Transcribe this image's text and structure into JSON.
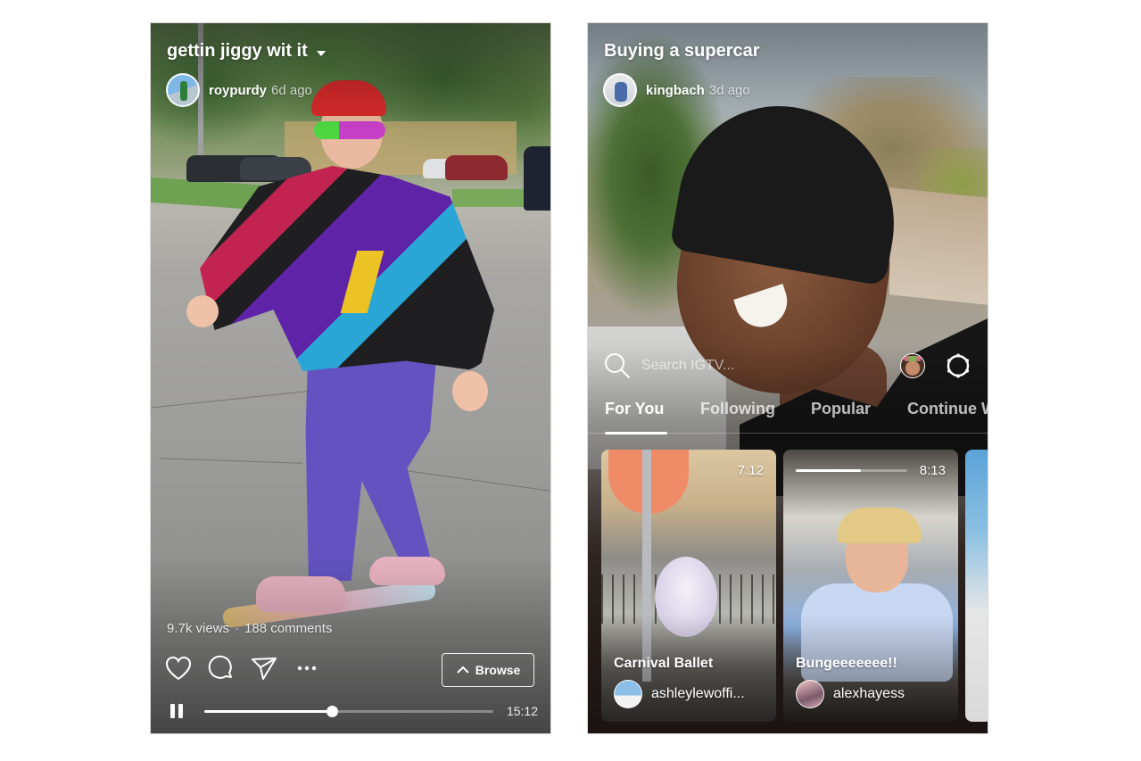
{
  "left_phone": {
    "video_title": "gettin jiggy wit it",
    "author": {
      "username": "roypurdy",
      "time_ago": "6d ago"
    },
    "stats": {
      "views": "9.7k views",
      "separator": "·",
      "comments": "188 comments"
    },
    "actions": [
      {
        "name": "like",
        "icon": "heart-icon"
      },
      {
        "name": "comment",
        "icon": "comment-bubble-icon"
      },
      {
        "name": "share",
        "icon": "paper-plane-icon"
      },
      {
        "name": "more",
        "icon": "ellipsis-icon"
      }
    ],
    "browse_label": "Browse",
    "player": {
      "state": "playing",
      "progress_fraction": 0.44,
      "duration": "15:12"
    }
  },
  "right_phone": {
    "video_title": "Buying a supercar",
    "author": {
      "username": "kingbach",
      "time_ago": "3d ago"
    },
    "search": {
      "placeholder": "Search IGTV..."
    },
    "tabs": [
      {
        "label": "For You",
        "active": true
      },
      {
        "label": "Following",
        "active": false
      },
      {
        "label": "Popular",
        "active": false
      },
      {
        "label": "Continue Watching",
        "active": false
      }
    ],
    "cards": [
      {
        "title": "Carnival Ballet",
        "author": "ashleylewoffi...",
        "duration": "7:12",
        "progress_fraction": null
      },
      {
        "title": "Bungeeeeeee!!",
        "author": "alexhayess",
        "duration": "8:13",
        "progress_fraction": 0.58
      }
    ]
  }
}
